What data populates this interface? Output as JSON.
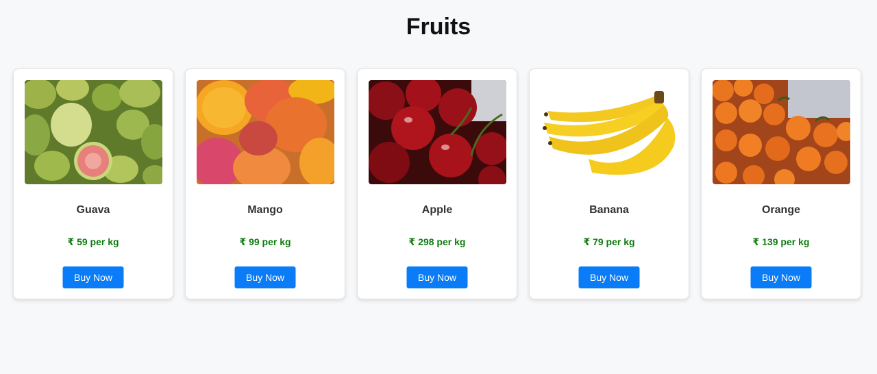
{
  "page": {
    "title": "Fruits"
  },
  "products": [
    {
      "name": "Guava",
      "price": "₹ 59 per kg",
      "button": "Buy Now",
      "image": "guava-image"
    },
    {
      "name": "Mango",
      "price": "₹ 99 per kg",
      "button": "Buy Now",
      "image": "mango-image"
    },
    {
      "name": "Apple",
      "price": "₹ 298 per kg",
      "button": "Buy Now",
      "image": "cherry-image"
    },
    {
      "name": "Banana",
      "price": "₹ 79 per kg",
      "button": "Buy Now",
      "image": "banana-image"
    },
    {
      "name": "Orange",
      "price": "₹ 139 per kg",
      "button": "Buy Now",
      "image": "orange-image"
    }
  ],
  "colors": {
    "background": "#f7f8fa",
    "price": "#0f7a0f",
    "button": "#0a7cf8"
  }
}
